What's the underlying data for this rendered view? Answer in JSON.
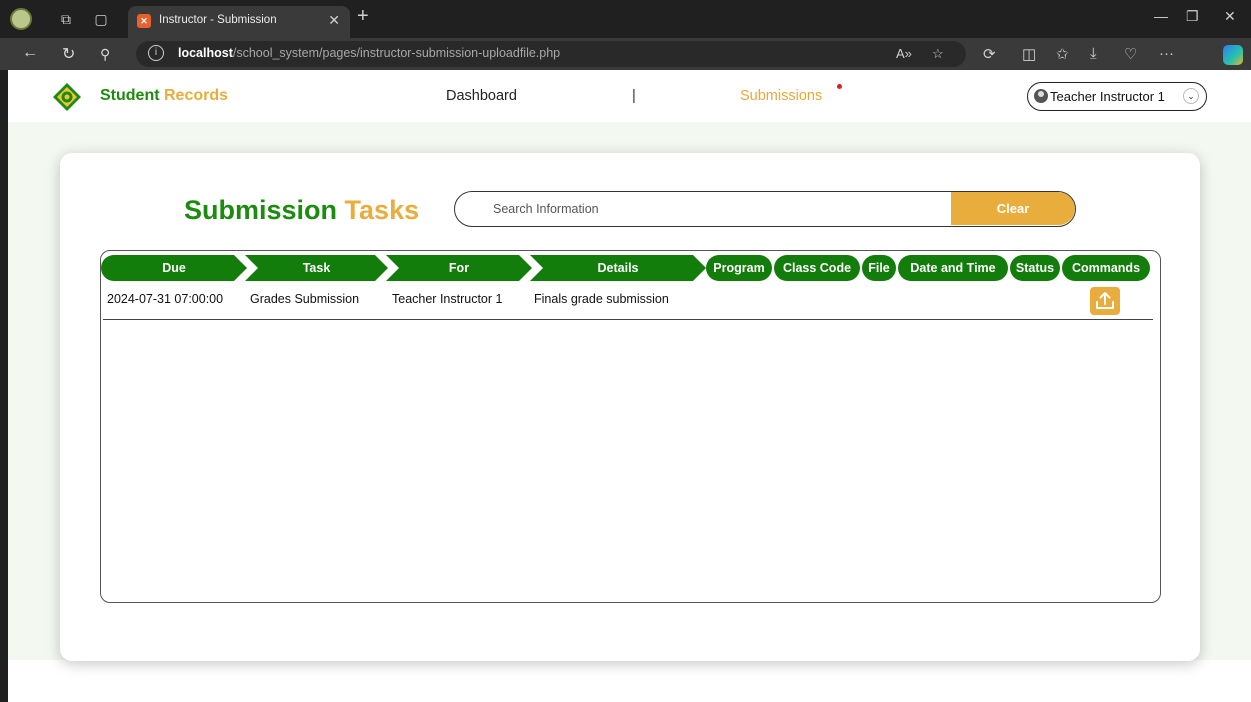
{
  "browser": {
    "tab_title": "Instructor - Submission",
    "tab_favicon": "xampp-icon",
    "url_host": "localhost",
    "url_path": "/school_system/pages/instructor-submission-uploadfile.php"
  },
  "navbar": {
    "brand_part1": "Student",
    "brand_part2": "Records",
    "links": [
      "Dashboard",
      "|",
      "Submissions"
    ],
    "active_link": "Submissions",
    "user_name": "Teacher Instructor 1"
  },
  "main": {
    "title_part1": "Submission",
    "title_part2": "Tasks",
    "search_placeholder": "Search Information",
    "clear_label": "Clear"
  },
  "table": {
    "columns": [
      "Due",
      "Task",
      "For",
      "Details",
      "Program",
      "Class Code",
      "File",
      "Date and Time",
      "Status",
      "Commands"
    ],
    "rows": [
      {
        "due": "2024-07-31 07:00:00",
        "task": "Grades Submission",
        "for": "Teacher Instructor 1",
        "details": "Finals grade submission",
        "program": "",
        "class_code": "",
        "file": "",
        "date_time": "",
        "status": "",
        "command_icon": "upload-icon"
      }
    ]
  },
  "colors": {
    "green": "#137d0b",
    "brand_green": "#1d8a10",
    "orange": "#e8ad3c",
    "band": "#f3f8f1"
  }
}
